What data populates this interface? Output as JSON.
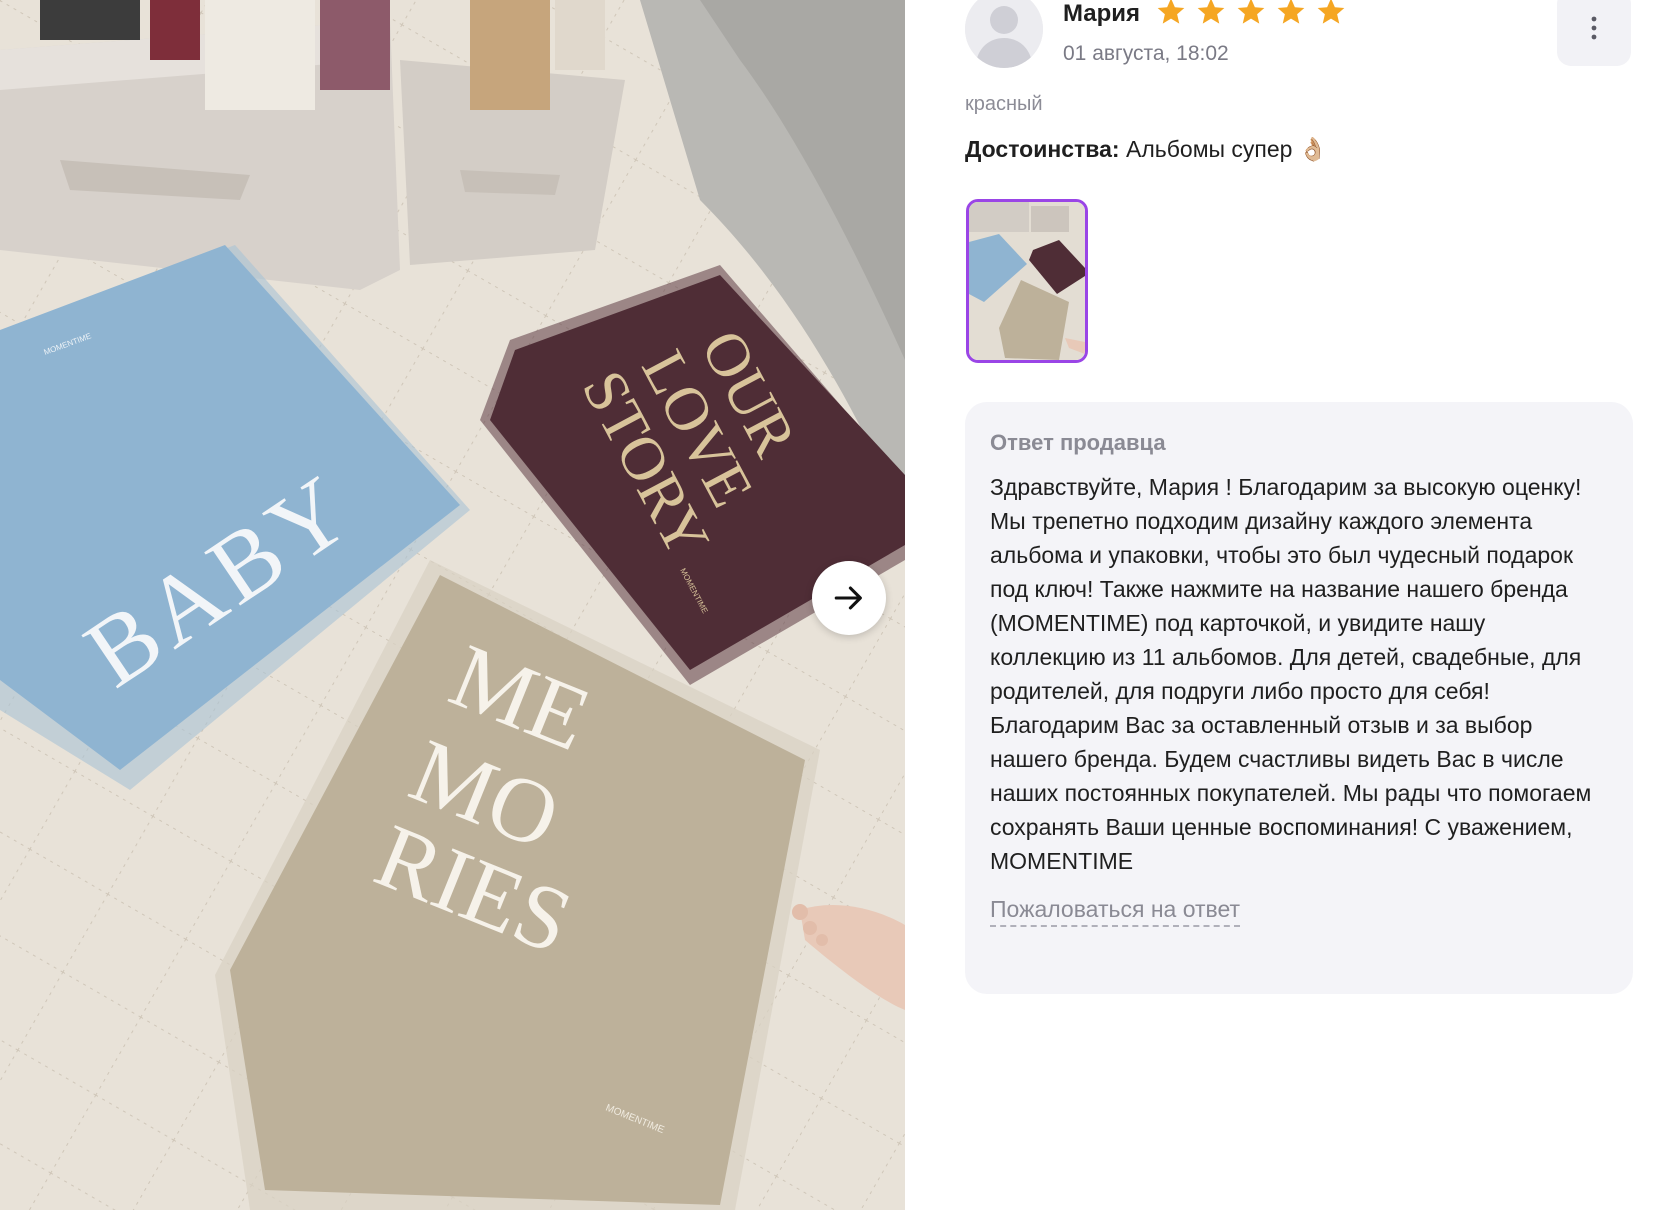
{
  "photo": {
    "next_label": "next-arrow",
    "book_titles": {
      "baby": "BABY",
      "love": [
        "OUR",
        "LOVE",
        "STORY"
      ],
      "memories": [
        "ME",
        "MO",
        "RIES"
      ],
      "brand_small": "MOMENTIME"
    }
  },
  "review": {
    "author": "Мария",
    "rating": 5,
    "date": "01 августа, 18:02",
    "variant": "красный",
    "pros_label": "Достоинства:",
    "pros_text": "Альбомы супер 👌🏼"
  },
  "seller_answer": {
    "title": "Ответ продавца",
    "text": "Здравствуйте, Мария ! Благодарим за высокую оценку! Мы трепетно подходим дизайну каждого элемента альбома и упаковки, чтобы это был чудесный подарок под ключ! Также нажмите на название нашего бренда (MOMENTIME) под карточкой, и увидите нашу коллекцию из 11 альбомов. Для детей, свадебные, для родителей, для подруги либо просто для себя! Благодарим Вас за оставленный отзыв и за выбор нашего бренда. Будем счастливы видеть Вас в числе наших постоянных покупателей. Мы рады что помогаем сохранять Ваши ценные воспоминания! С уважением, MOMENTIME",
    "complain_label": "Пожаловаться на ответ"
  },
  "colors": {
    "star": "#f5a623",
    "thumb_border": "#9a45e6",
    "answer_bg": "#f4f4f8"
  }
}
